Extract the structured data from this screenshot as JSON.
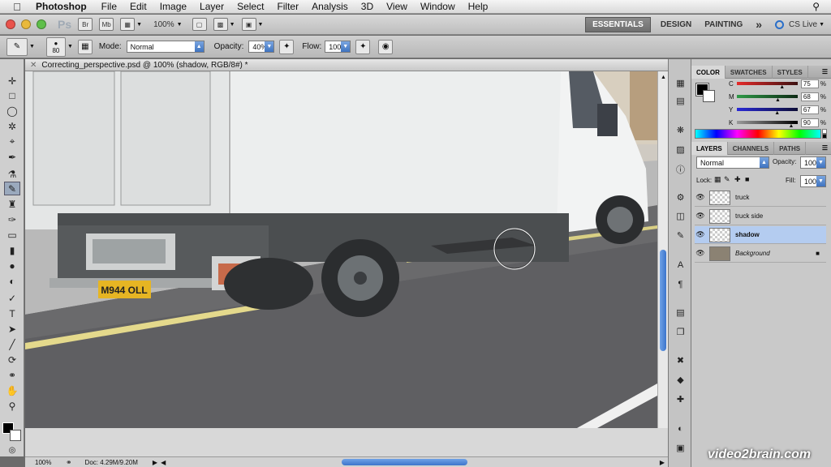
{
  "menubar": {
    "app_name": "Photoshop",
    "items": [
      "File",
      "Edit",
      "Image",
      "Layer",
      "Select",
      "Filter",
      "Analysis",
      "3D",
      "View",
      "Window",
      "Help"
    ]
  },
  "appbar": {
    "ps_logo": "Ps",
    "bridge": "Br",
    "minibridge": "Mb",
    "zoom": "100%",
    "workspaces": [
      "ESSENTIALS",
      "DESIGN",
      "PAINTING"
    ],
    "more": "»",
    "cs_live": "CS Live"
  },
  "options": {
    "brush_size": "80",
    "mode_label": "Mode:",
    "mode_value": "Normal",
    "opacity_label": "Opacity:",
    "opacity_value": "40%",
    "flow_label": "Flow:",
    "flow_value": "100%"
  },
  "document": {
    "tab_title": "Correcting_perspective.psd @ 100% (shadow, RGB/8#) *",
    "zoom": "100%",
    "doc_info": "Doc: 4.29M/9.20M",
    "license_plate": "M944 OLL"
  },
  "color_panel": {
    "tabs": [
      "COLOR",
      "SWATCHES",
      "STYLES"
    ],
    "channels": [
      {
        "label": "C",
        "value": "75",
        "unit": "%",
        "fraction": 0.75
      },
      {
        "label": "M",
        "value": "68",
        "unit": "%",
        "fraction": 0.68
      },
      {
        "label": "Y",
        "value": "67",
        "unit": "%",
        "fraction": 0.67
      },
      {
        "label": "K",
        "value": "90",
        "unit": "%",
        "fraction": 0.9
      }
    ]
  },
  "layers_panel": {
    "tabs": [
      "LAYERS",
      "CHANNELS",
      "PATHS"
    ],
    "blend_mode": "Normal",
    "opacity_label": "Opacity:",
    "opacity_value": "100%",
    "lock_label": "Lock:",
    "fill_label": "Fill:",
    "fill_value": "100%",
    "layers": [
      {
        "name": "truck",
        "selected": false
      },
      {
        "name": "truck side",
        "selected": false
      },
      {
        "name": "shadow",
        "selected": true
      },
      {
        "name": "Background",
        "selected": false,
        "locked": true
      }
    ]
  },
  "watermark": "video2brain.com",
  "colors": {
    "accent": "#3d75cc",
    "selection": "#b4ccf0",
    "panel": "#c9c9c9"
  }
}
